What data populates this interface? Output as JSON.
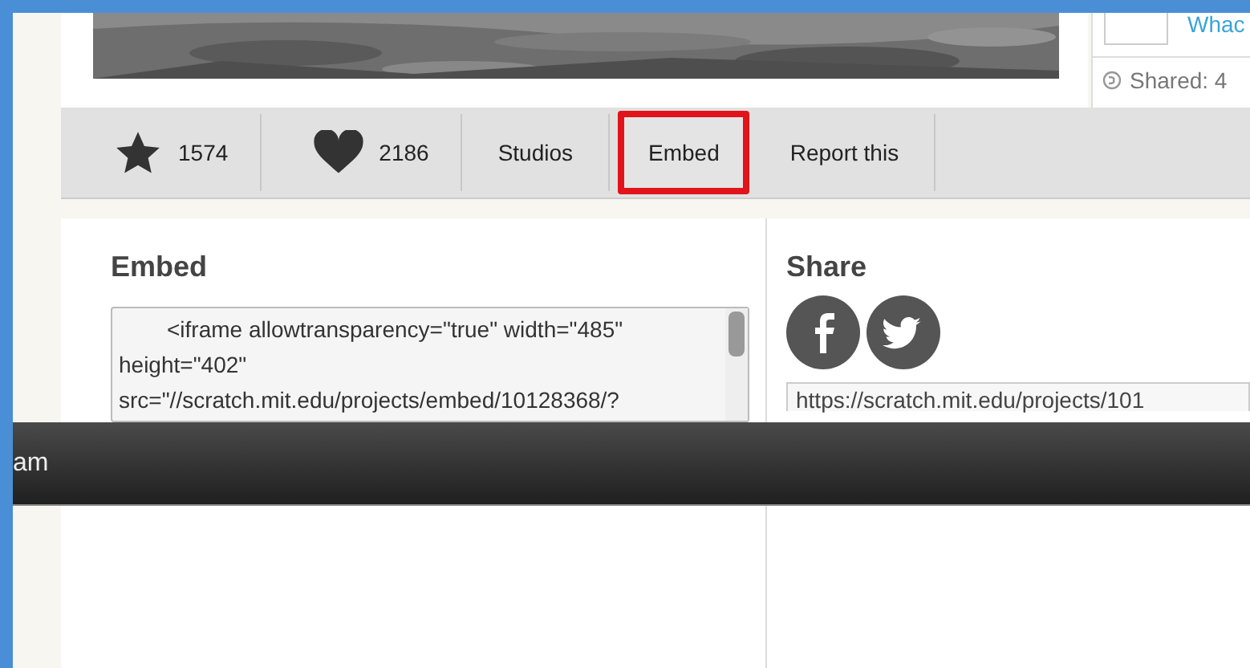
{
  "sidebar": {
    "link": "Whac",
    "shared": "Shared: 4"
  },
  "actions": [
    {
      "kind": "star",
      "label": "1574",
      "selected": false
    },
    {
      "kind": "heart",
      "label": "2186",
      "selected": false
    },
    {
      "kind": "text",
      "label": "Studios",
      "selected": false
    },
    {
      "kind": "text",
      "label": "Embed",
      "selected": true
    },
    {
      "kind": "text",
      "label": "Report this",
      "selected": false
    }
  ],
  "embed": {
    "title": "Embed",
    "code": "<iframe allowtransparency=\"true\" width=\"485\" height=\"402\" src=\"//scratch.mit.edu/projects/embed/10128368/?"
  },
  "share": {
    "title": "Share",
    "url": "https://scratch.mit.edu/projects/101"
  },
  "bottom_bar": {
    "text": "am"
  }
}
